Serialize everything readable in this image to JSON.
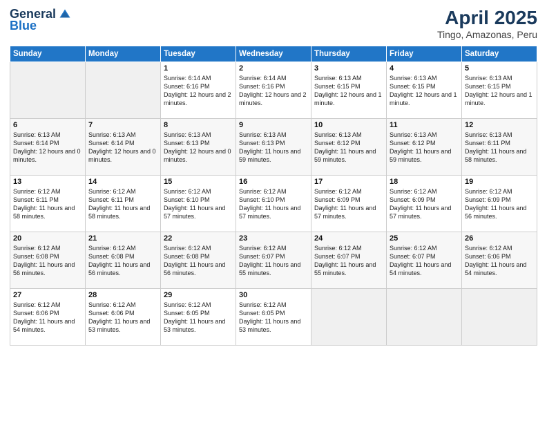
{
  "logo": {
    "general": "General",
    "blue": "Blue"
  },
  "title": {
    "main": "April 2025",
    "sub": "Tingo, Amazonas, Peru"
  },
  "days_of_week": [
    "Sunday",
    "Monday",
    "Tuesday",
    "Wednesday",
    "Thursday",
    "Friday",
    "Saturday"
  ],
  "weeks": [
    [
      {
        "day": "",
        "empty": true
      },
      {
        "day": "",
        "empty": true
      },
      {
        "day": "1",
        "sunrise": "6:14 AM",
        "sunset": "6:16 PM",
        "daylight": "12 hours and 2 minutes."
      },
      {
        "day": "2",
        "sunrise": "6:14 AM",
        "sunset": "6:16 PM",
        "daylight": "12 hours and 2 minutes."
      },
      {
        "day": "3",
        "sunrise": "6:13 AM",
        "sunset": "6:15 PM",
        "daylight": "12 hours and 1 minute."
      },
      {
        "day": "4",
        "sunrise": "6:13 AM",
        "sunset": "6:15 PM",
        "daylight": "12 hours and 1 minute."
      },
      {
        "day": "5",
        "sunrise": "6:13 AM",
        "sunset": "6:15 PM",
        "daylight": "12 hours and 1 minute."
      }
    ],
    [
      {
        "day": "6",
        "sunrise": "6:13 AM",
        "sunset": "6:14 PM",
        "daylight": "12 hours and 0 minutes."
      },
      {
        "day": "7",
        "sunrise": "6:13 AM",
        "sunset": "6:14 PM",
        "daylight": "12 hours and 0 minutes."
      },
      {
        "day": "8",
        "sunrise": "6:13 AM",
        "sunset": "6:13 PM",
        "daylight": "12 hours and 0 minutes."
      },
      {
        "day": "9",
        "sunrise": "6:13 AM",
        "sunset": "6:13 PM",
        "daylight": "11 hours and 59 minutes."
      },
      {
        "day": "10",
        "sunrise": "6:13 AM",
        "sunset": "6:12 PM",
        "daylight": "11 hours and 59 minutes."
      },
      {
        "day": "11",
        "sunrise": "6:13 AM",
        "sunset": "6:12 PM",
        "daylight": "11 hours and 59 minutes."
      },
      {
        "day": "12",
        "sunrise": "6:13 AM",
        "sunset": "6:11 PM",
        "daylight": "11 hours and 58 minutes."
      }
    ],
    [
      {
        "day": "13",
        "sunrise": "6:12 AM",
        "sunset": "6:11 PM",
        "daylight": "11 hours and 58 minutes."
      },
      {
        "day": "14",
        "sunrise": "6:12 AM",
        "sunset": "6:11 PM",
        "daylight": "11 hours and 58 minutes."
      },
      {
        "day": "15",
        "sunrise": "6:12 AM",
        "sunset": "6:10 PM",
        "daylight": "11 hours and 57 minutes."
      },
      {
        "day": "16",
        "sunrise": "6:12 AM",
        "sunset": "6:10 PM",
        "daylight": "11 hours and 57 minutes."
      },
      {
        "day": "17",
        "sunrise": "6:12 AM",
        "sunset": "6:09 PM",
        "daylight": "11 hours and 57 minutes."
      },
      {
        "day": "18",
        "sunrise": "6:12 AM",
        "sunset": "6:09 PM",
        "daylight": "11 hours and 57 minutes."
      },
      {
        "day": "19",
        "sunrise": "6:12 AM",
        "sunset": "6:09 PM",
        "daylight": "11 hours and 56 minutes."
      }
    ],
    [
      {
        "day": "20",
        "sunrise": "6:12 AM",
        "sunset": "6:08 PM",
        "daylight": "11 hours and 56 minutes."
      },
      {
        "day": "21",
        "sunrise": "6:12 AM",
        "sunset": "6:08 PM",
        "daylight": "11 hours and 56 minutes."
      },
      {
        "day": "22",
        "sunrise": "6:12 AM",
        "sunset": "6:08 PM",
        "daylight": "11 hours and 56 minutes."
      },
      {
        "day": "23",
        "sunrise": "6:12 AM",
        "sunset": "6:07 PM",
        "daylight": "11 hours and 55 minutes."
      },
      {
        "day": "24",
        "sunrise": "6:12 AM",
        "sunset": "6:07 PM",
        "daylight": "11 hours and 55 minutes."
      },
      {
        "day": "25",
        "sunrise": "6:12 AM",
        "sunset": "6:07 PM",
        "daylight": "11 hours and 54 minutes."
      },
      {
        "day": "26",
        "sunrise": "6:12 AM",
        "sunset": "6:06 PM",
        "daylight": "11 hours and 54 minutes."
      }
    ],
    [
      {
        "day": "27",
        "sunrise": "6:12 AM",
        "sunset": "6:06 PM",
        "daylight": "11 hours and 54 minutes."
      },
      {
        "day": "28",
        "sunrise": "6:12 AM",
        "sunset": "6:06 PM",
        "daylight": "11 hours and 53 minutes."
      },
      {
        "day": "29",
        "sunrise": "6:12 AM",
        "sunset": "6:05 PM",
        "daylight": "11 hours and 53 minutes."
      },
      {
        "day": "30",
        "sunrise": "6:12 AM",
        "sunset": "6:05 PM",
        "daylight": "11 hours and 53 minutes."
      },
      {
        "day": "",
        "empty": true
      },
      {
        "day": "",
        "empty": true
      },
      {
        "day": "",
        "empty": true
      }
    ]
  ]
}
